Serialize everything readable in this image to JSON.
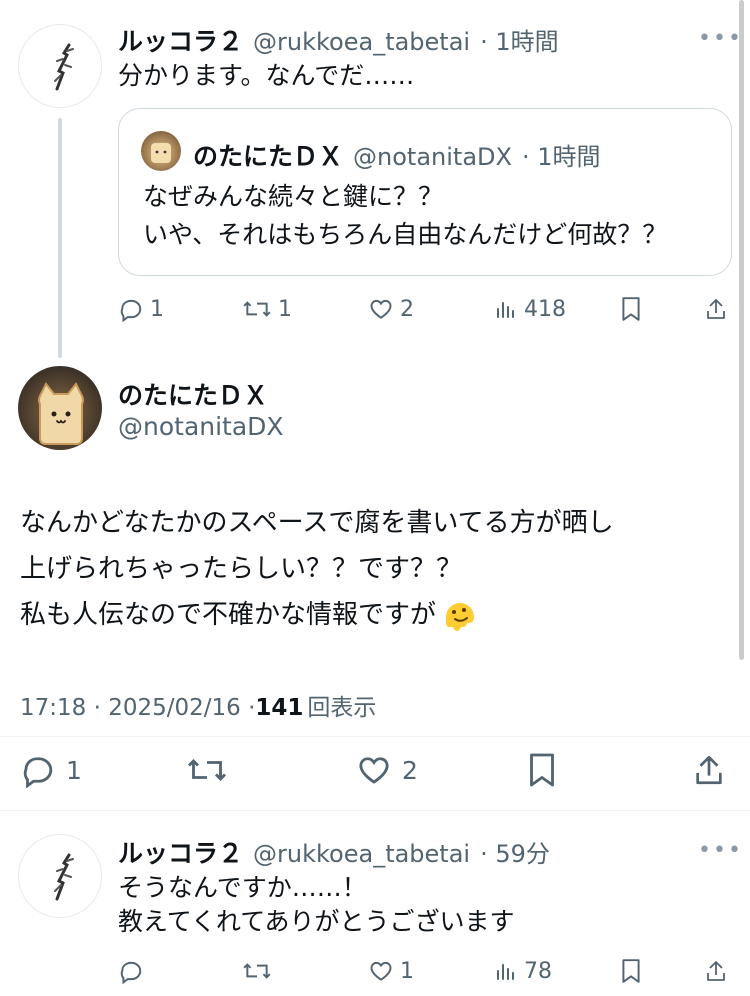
{
  "tweet1": {
    "name": "ルッコラ２",
    "handle": "@rukkoea_tabetai",
    "time": "· 1時間",
    "text": "分かります。なんでだ……",
    "quote": {
      "name": "のたにたＤＸ",
      "handle": "@notanitaDX",
      "time": "· 1時間",
      "line1": "なぜみんな続々と鍵に？？",
      "line2": "いや、それはもちろん自由なんだけど何故？？"
    },
    "replies": "1",
    "retweets": "1",
    "likes": "2",
    "views": "418"
  },
  "main": {
    "name": "のたにたＤＸ",
    "handle": "@notanitaDX",
    "line1": "なんかどなたかのスペースで腐を書いてる方が晒し",
    "line2": "上げられちゃったらしい？？です？？",
    "line3": "私も人伝なので不確かな情報ですが",
    "emoji_icon": "melting-face-emoji",
    "timestamp": "17:18 · 2025/02/16 · ",
    "view_count": "141",
    "view_label": "回表示",
    "replies": "1",
    "likes": "2"
  },
  "tweet3": {
    "name": "ルッコラ２",
    "handle": "@rukkoea_tabetai",
    "time": "· 59分",
    "line1": "そうなんですか……！",
    "line2": "教えてくれてありがとうございます",
    "likes": "1",
    "views": "78"
  },
  "more_label": "•••",
  "colors": {
    "text": "#0f1419",
    "muted": "#536471",
    "border": "#cfd9de"
  }
}
